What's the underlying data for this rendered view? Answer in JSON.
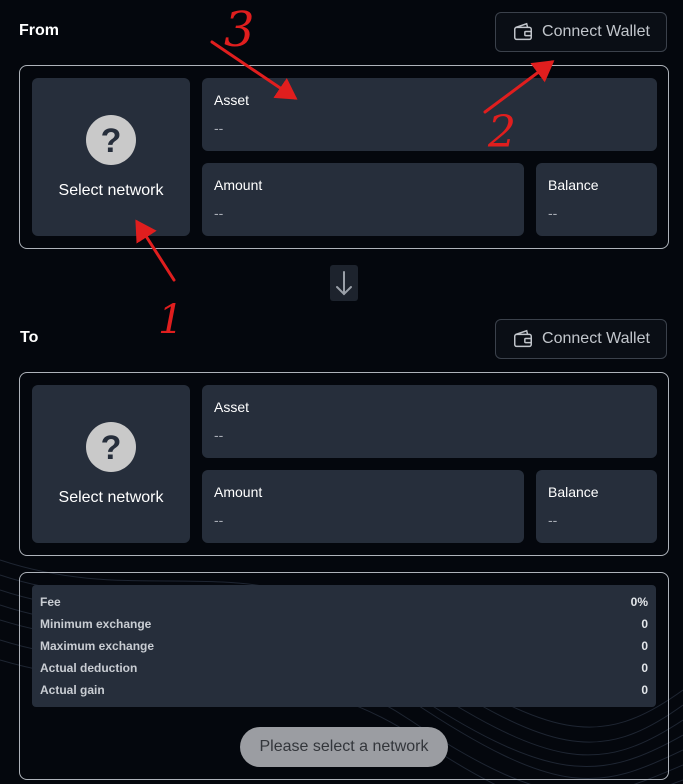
{
  "from": {
    "label": "From",
    "connect_wallet": "Connect Wallet",
    "network": "Select network",
    "asset_label": "Asset",
    "asset_value": "--",
    "amount_label": "Amount",
    "amount_value": "--",
    "balance_label": "Balance",
    "balance_value": "--"
  },
  "to": {
    "label": "To",
    "connect_wallet": "Connect Wallet",
    "network": "Select network",
    "asset_label": "Asset",
    "asset_value": "--",
    "amount_label": "Amount",
    "amount_value": "--",
    "balance_label": "Balance",
    "balance_value": "--"
  },
  "fees": [
    {
      "label": "Fee",
      "value": "0%"
    },
    {
      "label": "Minimum exchange",
      "value": "0"
    },
    {
      "label": "Maximum exchange",
      "value": "0"
    },
    {
      "label": "Actual deduction",
      "value": "0"
    },
    {
      "label": "Actual gain",
      "value": "0"
    }
  ],
  "submit_label": "Please select a network",
  "annotations": {
    "one": "1",
    "two": "2",
    "three": "3"
  },
  "colors": {
    "background": "#04070d",
    "card": "#262e3b",
    "arrow": "#e01e1e",
    "border": "#aeb3ba"
  },
  "icons": {
    "wallet": "wallet-icon",
    "unknown_network": "question-circle-icon",
    "swap": "arrow-down-icon"
  }
}
